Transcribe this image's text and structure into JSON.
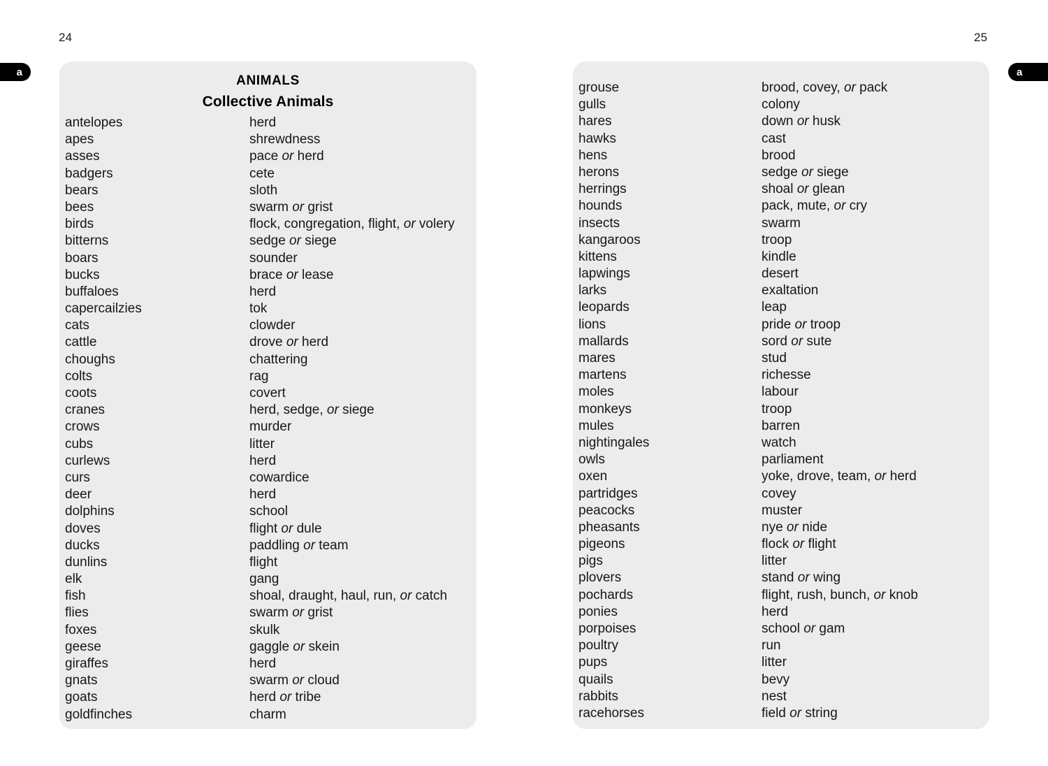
{
  "colors": {
    "panel_background": "#ececec",
    "page_background": "#ffffff",
    "tab_background": "#000000",
    "tab_text": "#ffffff",
    "body_text": "#161616"
  },
  "left_page": {
    "folio": "24",
    "thumb_tab": "a",
    "heading_main": "ANIMALS",
    "heading_sub": "Collective Animals",
    "entries": [
      {
        "term": "antelopes",
        "definition": "herd"
      },
      {
        "term": "apes",
        "definition": "shrewdness"
      },
      {
        "term": "asses",
        "definition": "pace <em>or</em> herd"
      },
      {
        "term": "badgers",
        "definition": "cete"
      },
      {
        "term": "bears",
        "definition": "sloth"
      },
      {
        "term": "bees",
        "definition": "swarm <em>or</em> grist"
      },
      {
        "term": "birds",
        "definition": "flock, congregation, flight, <em>or</em> volery"
      },
      {
        "term": "bitterns",
        "definition": "sedge <em>or</em> siege"
      },
      {
        "term": "boars",
        "definition": "sounder"
      },
      {
        "term": "bucks",
        "definition": "brace <em>or</em> lease"
      },
      {
        "term": "buffaloes",
        "definition": "herd"
      },
      {
        "term": "capercailzies",
        "definition": "tok"
      },
      {
        "term": "cats",
        "definition": "clowder"
      },
      {
        "term": "cattle",
        "definition": "drove <em>or</em> herd"
      },
      {
        "term": "choughs",
        "definition": "chattering"
      },
      {
        "term": "colts",
        "definition": "rag"
      },
      {
        "term": "coots",
        "definition": "covert"
      },
      {
        "term": "cranes",
        "definition": "herd, sedge, <em>or</em> siege"
      },
      {
        "term": "crows",
        "definition": "murder"
      },
      {
        "term": "cubs",
        "definition": "litter"
      },
      {
        "term": "curlews",
        "definition": "herd"
      },
      {
        "term": "curs",
        "definition": "cowardice"
      },
      {
        "term": "deer",
        "definition": "herd"
      },
      {
        "term": "dolphins",
        "definition": "school"
      },
      {
        "term": "doves",
        "definition": "flight <em>or</em> dule"
      },
      {
        "term": "ducks",
        "definition": "paddling <em>or</em> team"
      },
      {
        "term": "dunlins",
        "definition": "flight"
      },
      {
        "term": "elk",
        "definition": "gang"
      },
      {
        "term": "fish",
        "definition": "shoal, draught, haul, run, <em>or</em> catch"
      },
      {
        "term": "flies",
        "definition": "swarm <em>or</em> grist"
      },
      {
        "term": "foxes",
        "definition": "skulk"
      },
      {
        "term": "geese",
        "definition": "gaggle <em>or</em> skein"
      },
      {
        "term": "giraffes",
        "definition": "herd"
      },
      {
        "term": "gnats",
        "definition": "swarm <em>or</em> cloud"
      },
      {
        "term": "goats",
        "definition": "herd <em>or</em> tribe"
      },
      {
        "term": "goldfinches",
        "definition": "charm"
      }
    ]
  },
  "right_page": {
    "folio": "25",
    "thumb_tab": "a",
    "entries": [
      {
        "term": "grouse",
        "definition": "brood, covey, <em>or</em> pack"
      },
      {
        "term": "gulls",
        "definition": "colony"
      },
      {
        "term": "hares",
        "definition": "down <em>or</em> husk"
      },
      {
        "term": "hawks",
        "definition": "cast"
      },
      {
        "term": "hens",
        "definition": "brood"
      },
      {
        "term": "herons",
        "definition": "sedge <em>or</em> siege"
      },
      {
        "term": "herrings",
        "definition": "shoal <em>or</em> glean"
      },
      {
        "term": "hounds",
        "definition": "pack, mute, <em>or</em> cry"
      },
      {
        "term": "insects",
        "definition": "swarm"
      },
      {
        "term": "kangaroos",
        "definition": "troop"
      },
      {
        "term": "kittens",
        "definition": "kindle"
      },
      {
        "term": "lapwings",
        "definition": "desert"
      },
      {
        "term": "larks",
        "definition": "exaltation"
      },
      {
        "term": "leopards",
        "definition": "leap"
      },
      {
        "term": "lions",
        "definition": "pride <em>or</em> troop"
      },
      {
        "term": "mallards",
        "definition": "sord <em>or</em> sute"
      },
      {
        "term": "mares",
        "definition": "stud"
      },
      {
        "term": "martens",
        "definition": "richesse"
      },
      {
        "term": "moles",
        "definition": "labour"
      },
      {
        "term": "monkeys",
        "definition": "troop"
      },
      {
        "term": "mules",
        "definition": "barren"
      },
      {
        "term": "nightingales",
        "definition": "watch"
      },
      {
        "term": "owls",
        "definition": "parliament"
      },
      {
        "term": "oxen",
        "definition": "yoke, drove, team, <em>or</em> herd"
      },
      {
        "term": "partridges",
        "definition": "covey"
      },
      {
        "term": "peacocks",
        "definition": "muster"
      },
      {
        "term": "pheasants",
        "definition": "nye <em>or</em> nide"
      },
      {
        "term": "pigeons",
        "definition": "flock <em>or</em> flight"
      },
      {
        "term": "pigs",
        "definition": "litter"
      },
      {
        "term": "plovers",
        "definition": "stand <em>or</em> wing"
      },
      {
        "term": "pochards",
        "definition": "flight, rush, bunch, <em>or</em> knob"
      },
      {
        "term": "ponies",
        "definition": "herd"
      },
      {
        "term": "porpoises",
        "definition": "school <em>or</em> gam"
      },
      {
        "term": "poultry",
        "definition": "run"
      },
      {
        "term": "pups",
        "definition": "litter"
      },
      {
        "term": "quails",
        "definition": "bevy"
      },
      {
        "term": "rabbits",
        "definition": "nest"
      },
      {
        "term": "racehorses",
        "definition": "field <em>or</em> string"
      }
    ]
  }
}
